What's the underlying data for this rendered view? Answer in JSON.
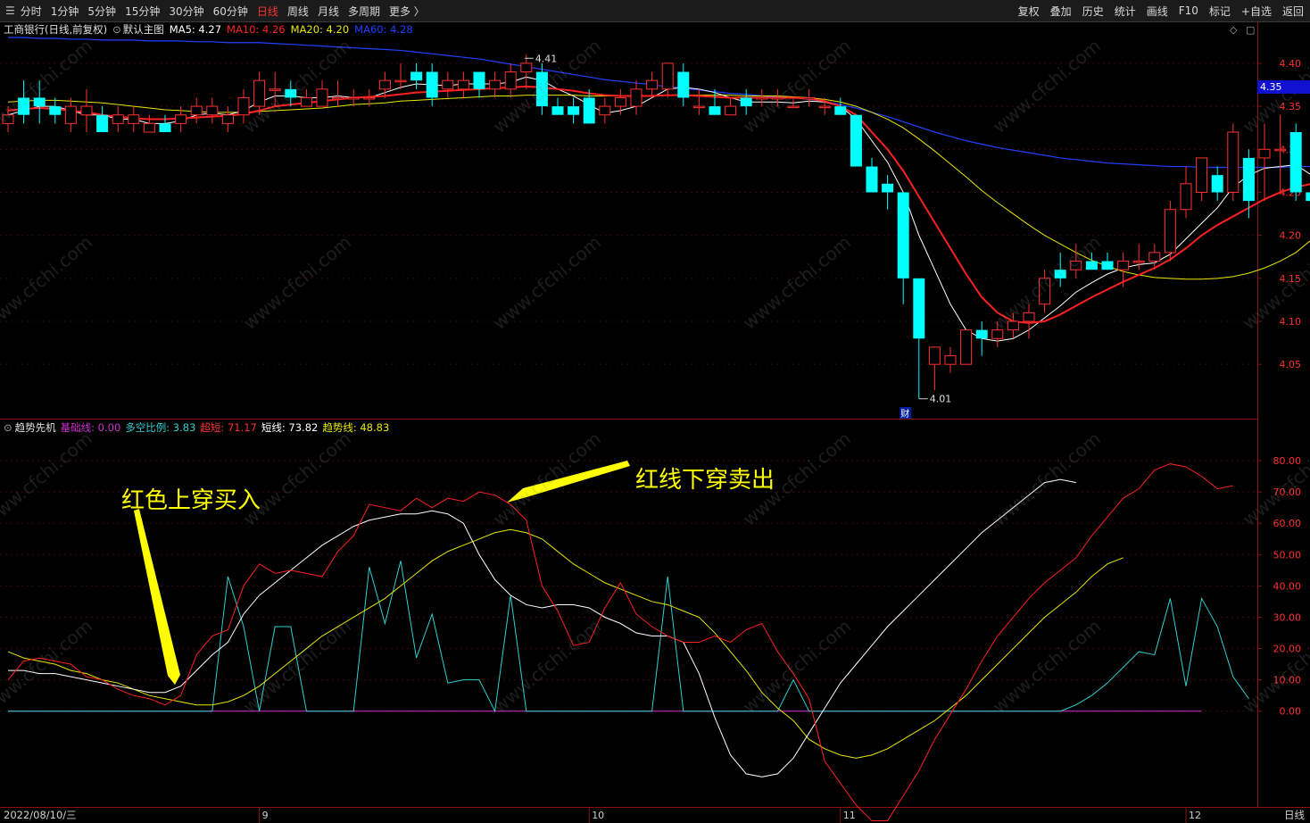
{
  "toolbar": {
    "periods": [
      "分时",
      "1分钟",
      "5分钟",
      "15分钟",
      "30分钟",
      "60分钟",
      "日线",
      "周线",
      "月线",
      "多周期",
      "更多 〉"
    ],
    "active_period": "日线",
    "actions": [
      "复权",
      "叠加",
      "历史",
      "统计",
      "画线",
      "F10",
      "标记",
      "+自选",
      "返回"
    ],
    "menu_glyph": "☰"
  },
  "main": {
    "stock_name": "工商银行(日线,前复权)",
    "template_label": "默认主图",
    "ma": [
      {
        "label": "MA5: 4.27",
        "color": "#ffffff"
      },
      {
        "label": "MA10: 4.26",
        "color": "#ff2020"
      },
      {
        "label": "MA20: 4.20",
        "color": "#e8e800"
      },
      {
        "label": "MA60: 4.28",
        "color": "#2040ff"
      }
    ],
    "price_ticks": [
      "4.40",
      "4.35",
      "4.30",
      "4.25",
      "4.20",
      "4.15",
      "4.10",
      "4.05"
    ],
    "current_price": "4.35",
    "high_label": "4.41",
    "low_label": "4.01",
    "event_marker": "财",
    "icons": [
      "◇",
      "▢"
    ],
    "colors": {
      "up": "#ff3030",
      "down": "#00ffff",
      "ma5": "#ffffff",
      "ma10": "#ff2020",
      "ma20": "#e8e800",
      "ma60": "#2040ff"
    }
  },
  "indicator": {
    "name": "趋势先机",
    "items": [
      {
        "label": "基础线: 0.00",
        "color": "#d030d0"
      },
      {
        "label": "多空比例: 3.83",
        "color": "#30d0d0"
      },
      {
        "label": "超短: 71.17",
        "color": "#ff3030"
      },
      {
        "label": "短线: 73.82",
        "color": "#ffffff"
      },
      {
        "label": "趋势线: 48.83",
        "color": "#e8e800"
      }
    ],
    "ticks": [
      "80.00",
      "70.00",
      "60.00",
      "50.00",
      "40.00",
      "30.00",
      "20.00",
      "10.00",
      "0.00"
    ]
  },
  "annotations": {
    "buy": "红色上穿买入",
    "sell": "红线下穿卖出"
  },
  "xaxis": {
    "start_date": "2022/08/10/三",
    "months": [
      "9",
      "10",
      "11",
      "12"
    ],
    "period": "日线"
  },
  "watermark": "www.cfchi.com",
  "chart_data": {
    "type": "candlestick",
    "price_range": [
      3.99,
      4.43
    ],
    "candles": [
      [
        4.33,
        4.34,
        4.32,
        4.35
      ],
      [
        4.36,
        4.34,
        4.33,
        4.38
      ],
      [
        4.36,
        4.35,
        4.33,
        4.38
      ],
      [
        4.35,
        4.34,
        4.33,
        4.36
      ],
      [
        4.33,
        4.35,
        4.32,
        4.36
      ],
      [
        4.34,
        4.35,
        4.32,
        4.37
      ],
      [
        4.34,
        4.32,
        4.32,
        4.35
      ],
      [
        4.33,
        4.34,
        4.32,
        4.35
      ],
      [
        4.33,
        4.34,
        4.32,
        4.35
      ],
      [
        4.32,
        4.33,
        4.32,
        4.34
      ],
      [
        4.33,
        4.32,
        4.32,
        4.34
      ],
      [
        4.33,
        4.34,
        4.32,
        4.35
      ],
      [
        4.34,
        4.35,
        4.33,
        4.36
      ],
      [
        4.34,
        4.35,
        4.33,
        4.36
      ],
      [
        4.33,
        4.34,
        4.32,
        4.35
      ],
      [
        4.34,
        4.36,
        4.33,
        4.37
      ],
      [
        4.35,
        4.38,
        4.34,
        4.39
      ],
      [
        4.37,
        4.37,
        4.35,
        4.39
      ],
      [
        4.37,
        4.36,
        4.35,
        4.38
      ],
      [
        4.35,
        4.36,
        4.35,
        4.37
      ],
      [
        4.35,
        4.37,
        4.35,
        4.38
      ],
      [
        4.36,
        4.36,
        4.35,
        4.38
      ],
      [
        4.36,
        4.36,
        4.35,
        4.37
      ],
      [
        4.36,
        4.36,
        4.35,
        4.37
      ],
      [
        4.37,
        4.38,
        4.36,
        4.39
      ],
      [
        4.38,
        4.38,
        4.37,
        4.4
      ],
      [
        4.39,
        4.38,
        4.37,
        4.4
      ],
      [
        4.39,
        4.36,
        4.35,
        4.4
      ],
      [
        4.37,
        4.38,
        4.36,
        4.39
      ],
      [
        4.37,
        4.38,
        4.36,
        4.39
      ],
      [
        4.39,
        4.37,
        4.36,
        4.39
      ],
      [
        4.37,
        4.38,
        4.36,
        4.39
      ],
      [
        4.37,
        4.39,
        4.36,
        4.4
      ],
      [
        4.39,
        4.4,
        4.37,
        4.41
      ],
      [
        4.39,
        4.35,
        4.34,
        4.4
      ],
      [
        4.35,
        4.34,
        4.34,
        4.36
      ],
      [
        4.35,
        4.34,
        4.33,
        4.36
      ],
      [
        4.36,
        4.33,
        4.33,
        4.37
      ],
      [
        4.34,
        4.35,
        4.33,
        4.36
      ],
      [
        4.35,
        4.36,
        4.34,
        4.37
      ],
      [
        4.35,
        4.37,
        4.34,
        4.38
      ],
      [
        4.37,
        4.38,
        4.36,
        4.39
      ],
      [
        4.37,
        4.4,
        4.36,
        4.4
      ],
      [
        4.39,
        4.36,
        4.35,
        4.4
      ],
      [
        4.35,
        4.35,
        4.34,
        4.37
      ],
      [
        4.35,
        4.34,
        4.34,
        4.37
      ],
      [
        4.34,
        4.35,
        4.34,
        4.36
      ],
      [
        4.36,
        4.35,
        4.34,
        4.37
      ],
      [
        4.36,
        4.36,
        4.35,
        4.37
      ],
      [
        4.36,
        4.36,
        4.35,
        4.37
      ],
      [
        4.35,
        4.35,
        4.35,
        4.36
      ],
      [
        4.36,
        4.36,
        4.35,
        4.37
      ],
      [
        4.35,
        4.35,
        4.34,
        4.36
      ],
      [
        4.35,
        4.34,
        4.34,
        4.36
      ],
      [
        4.34,
        4.28,
        4.28,
        4.34
      ],
      [
        4.28,
        4.25,
        4.25,
        4.29
      ],
      [
        4.26,
        4.25,
        4.23,
        4.27
      ],
      [
        4.25,
        4.15,
        4.12,
        4.25
      ],
      [
        4.15,
        4.08,
        4.01,
        4.15
      ],
      [
        4.05,
        4.07,
        4.02,
        4.07
      ],
      [
        4.05,
        4.06,
        4.04,
        4.07
      ],
      [
        4.05,
        4.09,
        4.05,
        4.09
      ],
      [
        4.09,
        4.08,
        4.06,
        4.1
      ],
      [
        4.08,
        4.09,
        4.07,
        4.1
      ],
      [
        4.09,
        4.1,
        4.08,
        4.11
      ],
      [
        4.1,
        4.11,
        4.08,
        4.12
      ],
      [
        4.12,
        4.15,
        4.11,
        4.16
      ],
      [
        4.16,
        4.15,
        4.14,
        4.18
      ],
      [
        4.16,
        4.17,
        4.15,
        4.19
      ],
      [
        4.17,
        4.16,
        4.16,
        4.18
      ],
      [
        4.17,
        4.16,
        4.16,
        4.18
      ],
      [
        4.16,
        4.17,
        4.14,
        4.18
      ],
      [
        4.17,
        4.17,
        4.16,
        4.19
      ],
      [
        4.17,
        4.18,
        4.16,
        4.19
      ],
      [
        4.18,
        4.23,
        4.17,
        4.24
      ],
      [
        4.23,
        4.26,
        4.22,
        4.28
      ],
      [
        4.25,
        4.29,
        4.24,
        4.29
      ],
      [
        4.27,
        4.25,
        4.24,
        4.28
      ],
      [
        4.25,
        4.32,
        4.24,
        4.33
      ],
      [
        4.29,
        4.24,
        4.22,
        4.3
      ],
      [
        4.29,
        4.3,
        4.24,
        4.33
      ],
      [
        4.3,
        4.3,
        4.25,
        4.34
      ],
      [
        4.32,
        4.25,
        4.24,
        4.33
      ],
      [
        4.25,
        4.24,
        4.23,
        4.26
      ]
    ],
    "ma5": [
      4.34,
      4.345,
      4.35,
      4.35,
      4.345,
      4.34,
      4.34,
      4.335,
      4.335,
      4.33,
      4.33,
      4.333,
      4.34,
      4.342,
      4.34,
      4.345,
      4.355,
      4.362,
      4.362,
      4.36,
      4.36,
      4.362,
      4.36,
      4.36,
      4.366,
      4.372,
      4.376,
      4.375,
      4.374,
      4.376,
      4.376,
      4.376,
      4.378,
      4.384,
      4.38,
      4.37,
      4.362,
      4.352,
      4.342,
      4.345,
      4.35,
      4.36,
      4.37,
      4.372,
      4.37,
      4.366,
      4.36,
      4.355,
      4.355,
      4.355,
      4.354,
      4.356,
      4.355,
      4.35,
      4.335,
      4.31,
      4.285,
      4.25,
      4.2,
      4.16,
      4.12,
      4.09,
      4.08,
      4.077,
      4.08,
      4.09,
      4.104,
      4.118,
      4.134,
      4.145,
      4.155,
      4.162,
      4.166,
      4.168,
      4.178,
      4.196,
      4.214,
      4.232,
      4.256,
      4.27,
      4.278,
      4.28,
      4.282,
      4.27
    ],
    "ma10": [
      4.345,
      4.347,
      4.348,
      4.347,
      4.345,
      4.343,
      4.34,
      4.338,
      4.336,
      4.335,
      4.335,
      4.336,
      4.337,
      4.338,
      4.339,
      4.341,
      4.345,
      4.35,
      4.352,
      4.354,
      4.356,
      4.358,
      4.36,
      4.361,
      4.362,
      4.364,
      4.366,
      4.367,
      4.368,
      4.369,
      4.37,
      4.371,
      4.372,
      4.373,
      4.372,
      4.37,
      4.368,
      4.365,
      4.363,
      4.362,
      4.362,
      4.362,
      4.363,
      4.363,
      4.362,
      4.361,
      4.36,
      4.36,
      4.36,
      4.36,
      4.36,
      4.359,
      4.356,
      4.35,
      4.34,
      4.32,
      4.3,
      4.275,
      4.245,
      4.215,
      4.185,
      4.155,
      4.128,
      4.11,
      4.1,
      4.098,
      4.1,
      4.108,
      4.118,
      4.128,
      4.137,
      4.146,
      4.154,
      4.162,
      4.172,
      4.185,
      4.2,
      4.212,
      4.222,
      4.232,
      4.242,
      4.25,
      4.256,
      4.26
    ],
    "ma20": [
      4.355,
      4.356,
      4.357,
      4.357,
      4.356,
      4.355,
      4.354,
      4.352,
      4.35,
      4.348,
      4.346,
      4.345,
      4.344,
      4.343,
      4.343,
      4.343,
      4.344,
      4.345,
      4.346,
      4.347,
      4.348,
      4.35,
      4.352,
      4.353,
      4.354,
      4.356,
      4.357,
      4.358,
      4.359,
      4.36,
      4.361,
      4.362,
      4.362,
      4.363,
      4.363,
      4.363,
      4.363,
      4.362,
      4.362,
      4.362,
      4.362,
      4.362,
      4.363,
      4.363,
      4.363,
      4.363,
      4.363,
      4.362,
      4.362,
      4.362,
      4.361,
      4.36,
      4.358,
      4.355,
      4.35,
      4.343,
      4.335,
      4.325,
      4.312,
      4.298,
      4.283,
      4.268,
      4.252,
      4.238,
      4.225,
      4.212,
      4.2,
      4.19,
      4.18,
      4.171,
      4.164,
      4.158,
      4.154,
      4.151,
      4.15,
      4.149,
      4.149,
      4.15,
      4.152,
      4.156,
      4.162,
      4.17,
      4.18,
      4.195
    ],
    "ma60": [
      4.43,
      4.43,
      4.429,
      4.429,
      4.428,
      4.428,
      4.427,
      4.427,
      4.427,
      4.426,
      4.426,
      4.426,
      4.425,
      4.425,
      4.424,
      4.424,
      4.424,
      4.423,
      4.422,
      4.421,
      4.42,
      4.419,
      4.418,
      4.417,
      4.416,
      4.415,
      4.413,
      4.411,
      4.409,
      4.407,
      4.405,
      4.402,
      4.399,
      4.396,
      4.393,
      4.39,
      4.387,
      4.384,
      4.381,
      4.379,
      4.377,
      4.375,
      4.373,
      4.371,
      4.369,
      4.367,
      4.365,
      4.364,
      4.362,
      4.361,
      4.36,
      4.358,
      4.356,
      4.352,
      4.348,
      4.343,
      4.338,
      4.332,
      4.326,
      4.32,
      4.315,
      4.31,
      4.306,
      4.302,
      4.299,
      4.296,
      4.293,
      4.29,
      4.288,
      4.286,
      4.284,
      4.283,
      4.282,
      4.281,
      4.28,
      4.28,
      4.279,
      4.279,
      4.279,
      4.279,
      4.279,
      4.279,
      4.28,
      4.28
    ],
    "osc_range": [
      -30,
      88
    ],
    "chaoduan": [
      10,
      16,
      17,
      16,
      15,
      11,
      10,
      7,
      5,
      4,
      2,
      5,
      18,
      24,
      26,
      40,
      47,
      44,
      45,
      44,
      43,
      51,
      56,
      66,
      65,
      64,
      68,
      65,
      68,
      67,
      70,
      69,
      66,
      61,
      40,
      32,
      21,
      22,
      33,
      41,
      31,
      27,
      24,
      22,
      22,
      24,
      22,
      26,
      28,
      19,
      12,
      4,
      -16,
      -23,
      -30,
      -35,
      -35,
      -27,
      -19,
      -9,
      -1,
      7,
      16,
      24,
      30,
      36,
      41,
      45,
      49,
      56,
      62,
      68,
      71,
      77,
      79,
      78,
      75,
      71,
      72
    ],
    "duanxian": [
      13,
      13,
      12,
      12,
      11,
      10,
      9,
      8,
      7,
      6,
      6,
      8,
      13,
      18,
      22,
      31,
      37,
      41,
      45,
      49,
      53,
      56,
      59,
      61,
      62,
      63,
      63,
      64,
      63,
      60,
      50,
      42,
      37,
      34,
      33,
      34,
      34,
      33,
      30,
      28,
      25,
      24,
      24,
      22,
      12,
      -2,
      -14,
      -20,
      -21,
      -20,
      -15,
      -7,
      1,
      9,
      15,
      21,
      27,
      32,
      37,
      42,
      47,
      52,
      57,
      61,
      65,
      69,
      73,
      74,
      73
    ],
    "trendline": [
      19,
      17,
      16,
      15,
      13,
      12,
      10,
      9,
      7,
      5,
      4,
      3,
      2,
      2,
      3,
      5,
      8,
      12,
      16,
      20,
      24,
      27,
      30,
      33,
      36,
      40,
      44,
      48,
      51,
      53,
      55,
      57,
      58,
      57,
      55,
      51,
      47,
      44,
      41,
      39,
      37,
      35,
      34,
      32,
      30,
      25,
      19,
      13,
      6,
      1,
      -3,
      -9,
      -12,
      -14,
      -15,
      -14,
      -12,
      -9,
      -6,
      -3,
      1,
      5,
      10,
      15,
      20,
      25,
      30,
      34,
      38,
      43,
      47,
      49
    ],
    "duokong": [
      0,
      0,
      0,
      0,
      0,
      0,
      0,
      0,
      0,
      0,
      0,
      0,
      0,
      0,
      43,
      27,
      0,
      27,
      27,
      0,
      0,
      0,
      0,
      46,
      28,
      48,
      17,
      31,
      9,
      10,
      10,
      0,
      37,
      0,
      0,
      0,
      0,
      0,
      0,
      0,
      0,
      0,
      43,
      0,
      0,
      0,
      0,
      0,
      0,
      0,
      10,
      0,
      0,
      0,
      0,
      0,
      0,
      0,
      0,
      0,
      0,
      0,
      0,
      0,
      0,
      0,
      0,
      0,
      2,
      5,
      9,
      14,
      19,
      18,
      36,
      8,
      36,
      27,
      11,
      4
    ]
  }
}
